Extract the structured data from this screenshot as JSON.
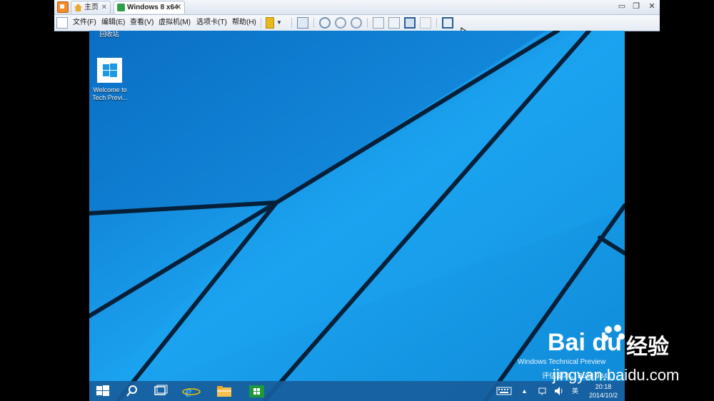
{
  "vm_tabs": {
    "home": "主页",
    "vm": "Windows 8 x64"
  },
  "vm_menu": [
    "文件(F)",
    "编辑(E)",
    "查看(V)",
    "虚拟机(M)",
    "选项卡(T)",
    "帮助(H)"
  ],
  "desktop_icons": {
    "recycle_bin": "回收站",
    "welcome": "Welcome to Tech Previ..."
  },
  "watermark": {
    "line1": "Windows Technical Preview",
    "line2": "评估副本。Build 9841"
  },
  "tray": {
    "ime": "英",
    "time": "20:18",
    "date": "2014/10/2"
  },
  "baidu": {
    "logo": "Bai du",
    "jingyan": "经验",
    "url": "jingyan.baidu.com"
  },
  "colors": {
    "desktop_blue": "#1398e8",
    "taskbar": "#175d9c",
    "vmware_orange": "#f28c28"
  }
}
